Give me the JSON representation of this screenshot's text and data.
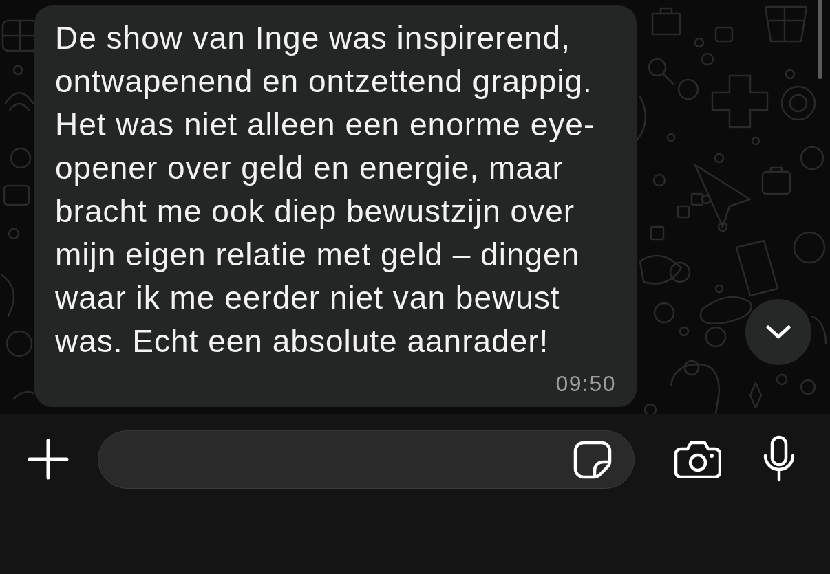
{
  "message": {
    "text": "De show van Inge was inspirerend, ontwapenend en ontzettend grappig. Het was niet alleen een enorme eye-opener over geld en energie, maar bracht me ook diep bewustzijn over mijn eigen relatie met geld – dingen waar ik me eerder niet van bewust was. Echt een absolute aanrader!",
    "time": "09:50"
  }
}
